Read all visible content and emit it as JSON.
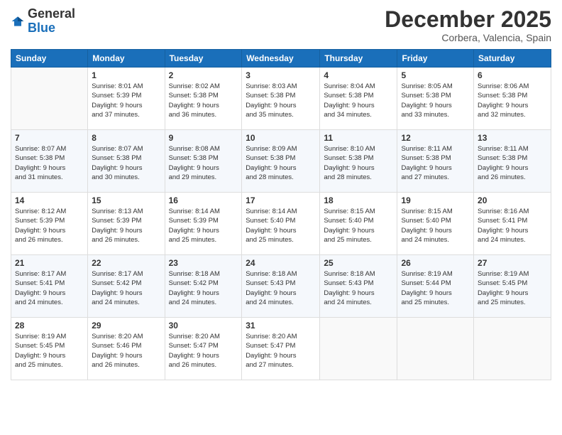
{
  "logo": {
    "general": "General",
    "blue": "Blue"
  },
  "header": {
    "month": "December 2025",
    "location": "Corbera, Valencia, Spain"
  },
  "weekdays": [
    "Sunday",
    "Monday",
    "Tuesday",
    "Wednesday",
    "Thursday",
    "Friday",
    "Saturday"
  ],
  "weeks": [
    [
      {
        "day": "",
        "info": ""
      },
      {
        "day": "1",
        "info": "Sunrise: 8:01 AM\nSunset: 5:39 PM\nDaylight: 9 hours\nand 37 minutes."
      },
      {
        "day": "2",
        "info": "Sunrise: 8:02 AM\nSunset: 5:38 PM\nDaylight: 9 hours\nand 36 minutes."
      },
      {
        "day": "3",
        "info": "Sunrise: 8:03 AM\nSunset: 5:38 PM\nDaylight: 9 hours\nand 35 minutes."
      },
      {
        "day": "4",
        "info": "Sunrise: 8:04 AM\nSunset: 5:38 PM\nDaylight: 9 hours\nand 34 minutes."
      },
      {
        "day": "5",
        "info": "Sunrise: 8:05 AM\nSunset: 5:38 PM\nDaylight: 9 hours\nand 33 minutes."
      },
      {
        "day": "6",
        "info": "Sunrise: 8:06 AM\nSunset: 5:38 PM\nDaylight: 9 hours\nand 32 minutes."
      }
    ],
    [
      {
        "day": "7",
        "info": "Sunrise: 8:07 AM\nSunset: 5:38 PM\nDaylight: 9 hours\nand 31 minutes."
      },
      {
        "day": "8",
        "info": "Sunrise: 8:07 AM\nSunset: 5:38 PM\nDaylight: 9 hours\nand 30 minutes."
      },
      {
        "day": "9",
        "info": "Sunrise: 8:08 AM\nSunset: 5:38 PM\nDaylight: 9 hours\nand 29 minutes."
      },
      {
        "day": "10",
        "info": "Sunrise: 8:09 AM\nSunset: 5:38 PM\nDaylight: 9 hours\nand 28 minutes."
      },
      {
        "day": "11",
        "info": "Sunrise: 8:10 AM\nSunset: 5:38 PM\nDaylight: 9 hours\nand 28 minutes."
      },
      {
        "day": "12",
        "info": "Sunrise: 8:11 AM\nSunset: 5:38 PM\nDaylight: 9 hours\nand 27 minutes."
      },
      {
        "day": "13",
        "info": "Sunrise: 8:11 AM\nSunset: 5:38 PM\nDaylight: 9 hours\nand 26 minutes."
      }
    ],
    [
      {
        "day": "14",
        "info": "Sunrise: 8:12 AM\nSunset: 5:39 PM\nDaylight: 9 hours\nand 26 minutes."
      },
      {
        "day": "15",
        "info": "Sunrise: 8:13 AM\nSunset: 5:39 PM\nDaylight: 9 hours\nand 26 minutes."
      },
      {
        "day": "16",
        "info": "Sunrise: 8:14 AM\nSunset: 5:39 PM\nDaylight: 9 hours\nand 25 minutes."
      },
      {
        "day": "17",
        "info": "Sunrise: 8:14 AM\nSunset: 5:40 PM\nDaylight: 9 hours\nand 25 minutes."
      },
      {
        "day": "18",
        "info": "Sunrise: 8:15 AM\nSunset: 5:40 PM\nDaylight: 9 hours\nand 25 minutes."
      },
      {
        "day": "19",
        "info": "Sunrise: 8:15 AM\nSunset: 5:40 PM\nDaylight: 9 hours\nand 24 minutes."
      },
      {
        "day": "20",
        "info": "Sunrise: 8:16 AM\nSunset: 5:41 PM\nDaylight: 9 hours\nand 24 minutes."
      }
    ],
    [
      {
        "day": "21",
        "info": "Sunrise: 8:17 AM\nSunset: 5:41 PM\nDaylight: 9 hours\nand 24 minutes."
      },
      {
        "day": "22",
        "info": "Sunrise: 8:17 AM\nSunset: 5:42 PM\nDaylight: 9 hours\nand 24 minutes."
      },
      {
        "day": "23",
        "info": "Sunrise: 8:18 AM\nSunset: 5:42 PM\nDaylight: 9 hours\nand 24 minutes."
      },
      {
        "day": "24",
        "info": "Sunrise: 8:18 AM\nSunset: 5:43 PM\nDaylight: 9 hours\nand 24 minutes."
      },
      {
        "day": "25",
        "info": "Sunrise: 8:18 AM\nSunset: 5:43 PM\nDaylight: 9 hours\nand 24 minutes."
      },
      {
        "day": "26",
        "info": "Sunrise: 8:19 AM\nSunset: 5:44 PM\nDaylight: 9 hours\nand 25 minutes."
      },
      {
        "day": "27",
        "info": "Sunrise: 8:19 AM\nSunset: 5:45 PM\nDaylight: 9 hours\nand 25 minutes."
      }
    ],
    [
      {
        "day": "28",
        "info": "Sunrise: 8:19 AM\nSunset: 5:45 PM\nDaylight: 9 hours\nand 25 minutes."
      },
      {
        "day": "29",
        "info": "Sunrise: 8:20 AM\nSunset: 5:46 PM\nDaylight: 9 hours\nand 26 minutes."
      },
      {
        "day": "30",
        "info": "Sunrise: 8:20 AM\nSunset: 5:47 PM\nDaylight: 9 hours\nand 26 minutes."
      },
      {
        "day": "31",
        "info": "Sunrise: 8:20 AM\nSunset: 5:47 PM\nDaylight: 9 hours\nand 27 minutes."
      },
      {
        "day": "",
        "info": ""
      },
      {
        "day": "",
        "info": ""
      },
      {
        "day": "",
        "info": ""
      }
    ]
  ]
}
